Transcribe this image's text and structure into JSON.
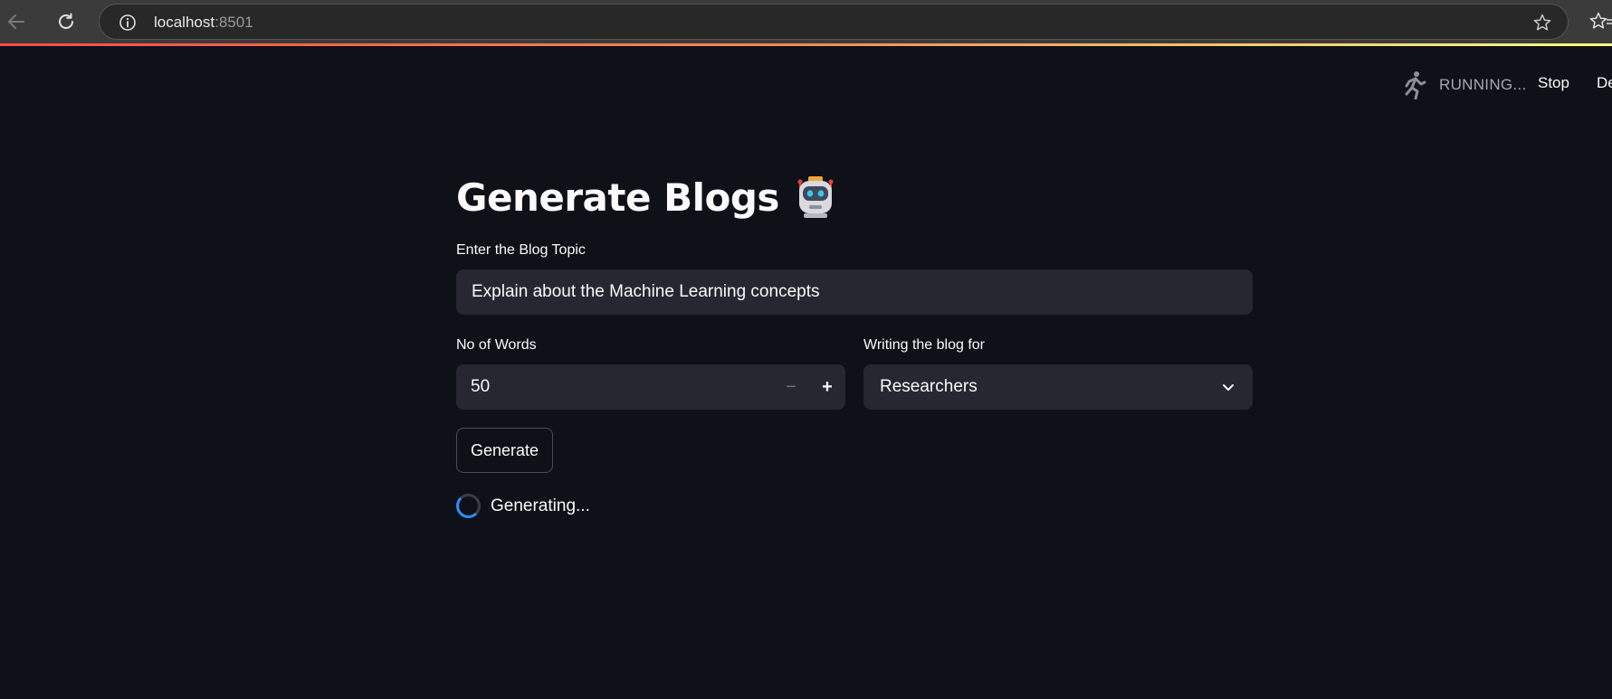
{
  "browser": {
    "url_host": "localhost",
    "url_port": ":8501"
  },
  "status": {
    "running_text": "RUNNING...",
    "stop_label": "Stop",
    "deploy_label": "Deploy"
  },
  "page": {
    "title": "Generate Blogs",
    "title_emoji": "robot-face-icon"
  },
  "form": {
    "topic": {
      "label": "Enter the Blog Topic",
      "value": "Explain about the Machine Learning concepts"
    },
    "words": {
      "label": "No of Words",
      "value": "50",
      "minus": "−",
      "plus": "+"
    },
    "audience": {
      "label": "Writing the blog for",
      "selected": "Researchers"
    },
    "generate_label": "Generate",
    "spinner_text": "Generating..."
  },
  "colors": {
    "background": "#0e1117",
    "input_background": "#262730",
    "text": "#fafafa",
    "muted_text": "#a3a8b4",
    "spinner_accent": "#2e8fff",
    "progress_start": "#ff4b4b",
    "progress_end": "#fffd80"
  }
}
